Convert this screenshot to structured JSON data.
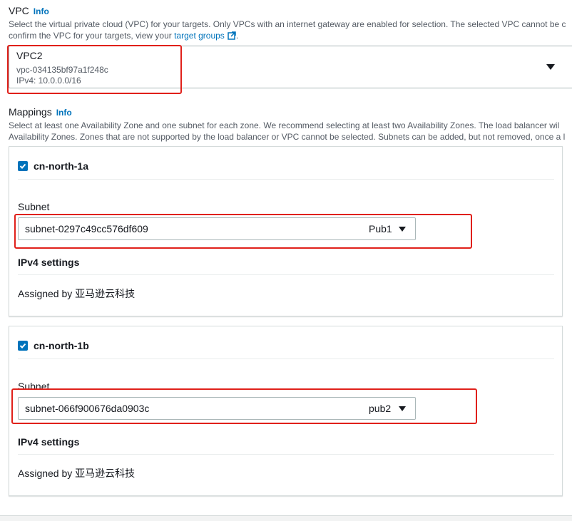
{
  "vpc": {
    "label": "VPC",
    "info": "Info",
    "desc_line1": "Select the virtual private cloud (VPC) for your targets. Only VPCs with an internet gateway are enabled for selection. The selected VPC cannot be c",
    "desc_line2_prefix": "confirm the VPC for your targets, view your ",
    "desc_link": "target groups",
    "desc_line2_suffix": ".",
    "selected": {
      "name": "VPC2",
      "id": "vpc-034135bf97a1f248c",
      "cidr": "IPv4: 10.0.0.0/16"
    }
  },
  "mappings": {
    "label": "Mappings",
    "info": "Info",
    "desc_line1": "Select at least one Availability Zone and one subnet for each zone. We recommend selecting at least two Availability Zones. The load balancer wil",
    "desc_line2": "Availability Zones. Zones that are not supported by the load balancer or VPC cannot be selected. Subnets can be added, but not removed, once a l",
    "zones": [
      {
        "name": "cn-north-1a",
        "subnet_label": "Subnet",
        "subnet_id": "subnet-0297c49cc576df609",
        "subnet_tag": "Pub1",
        "ipv4_title": "IPv4 settings",
        "ipv4_value": "Assigned by 亚马逊云科技"
      },
      {
        "name": "cn-north-1b",
        "subnet_label": "Subnet",
        "subnet_id": "subnet-066f900676da0903c",
        "subnet_tag": "pub2",
        "ipv4_title": "IPv4 settings",
        "ipv4_value": "Assigned by 亚马逊云科技"
      }
    ]
  },
  "colors": {
    "link": "#0073bb",
    "checkbox": "#0073bb",
    "highlight": "#e0201a"
  }
}
